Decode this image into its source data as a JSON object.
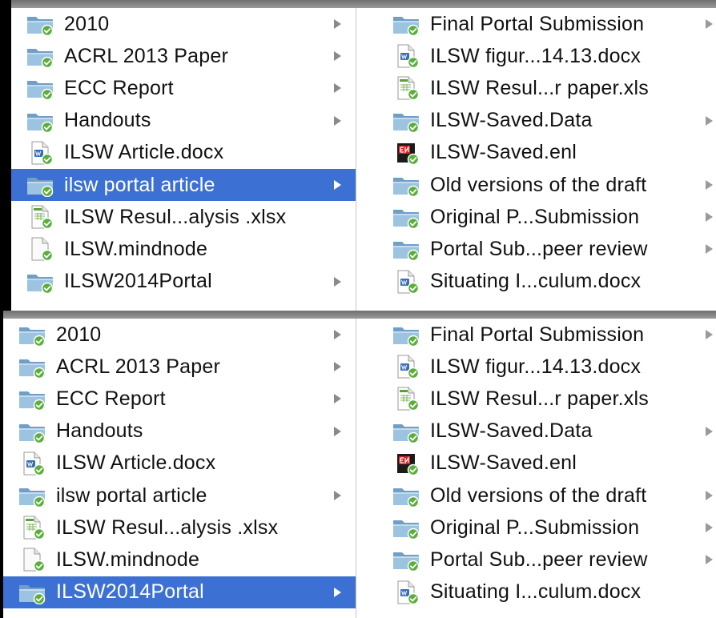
{
  "panes": [
    {
      "left_items": [
        {
          "label": "2010",
          "icon": "folder-synced-icon",
          "arrow": true,
          "selected": false
        },
        {
          "label": "ACRL 2013 Paper",
          "icon": "folder-synced-icon",
          "arrow": true,
          "selected": false
        },
        {
          "label": "ECC Report",
          "icon": "folder-synced-icon",
          "arrow": true,
          "selected": false
        },
        {
          "label": "Handouts",
          "icon": "folder-synced-icon",
          "arrow": true,
          "selected": false
        },
        {
          "label": "ILSW Article.docx",
          "icon": "word-document-synced-icon",
          "arrow": false,
          "selected": false
        },
        {
          "label": "ilsw portal article",
          "icon": "folder-synced-icon",
          "arrow": true,
          "selected": true
        },
        {
          "label": "ILSW Resul...alysis .xlsx",
          "icon": "excel-document-synced-icon",
          "arrow": false,
          "selected": false
        },
        {
          "label": "ILSW.mindnode",
          "icon": "blank-document-synced-icon",
          "arrow": false,
          "selected": false
        },
        {
          "label": "ILSW2014Portal",
          "icon": "folder-synced-icon",
          "arrow": true,
          "selected": false
        }
      ],
      "right_items": [
        {
          "label": "Final Portal Submission",
          "icon": "folder-synced-icon",
          "arrow": true
        },
        {
          "label": "ILSW figur...14.13.docx",
          "icon": "word-document-synced-icon",
          "arrow": false
        },
        {
          "label": "ILSW Resul...r paper.xls",
          "icon": "excel-document-synced-icon",
          "arrow": false
        },
        {
          "label": "ILSW-Saved.Data",
          "icon": "folder-synced-icon",
          "arrow": true
        },
        {
          "label": "ILSW-Saved.enl",
          "icon": "endnote-library-synced-icon",
          "arrow": false
        },
        {
          "label": "Old versions of the draft",
          "icon": "folder-synced-icon",
          "arrow": true
        },
        {
          "label": "Original P...Submission",
          "icon": "folder-synced-icon",
          "arrow": true
        },
        {
          "label": "Portal Sub...peer review",
          "icon": "folder-synced-icon",
          "arrow": true
        },
        {
          "label": "Situating I...culum.docx",
          "icon": "word-document-synced-icon",
          "arrow": false
        }
      ]
    },
    {
      "left_items": [
        {
          "label": "2010",
          "icon": "folder-synced-icon",
          "arrow": true,
          "selected": false
        },
        {
          "label": "ACRL 2013 Paper",
          "icon": "folder-synced-icon",
          "arrow": true,
          "selected": false
        },
        {
          "label": "ECC Report",
          "icon": "folder-synced-icon",
          "arrow": true,
          "selected": false
        },
        {
          "label": "Handouts",
          "icon": "folder-synced-icon",
          "arrow": true,
          "selected": false
        },
        {
          "label": "ILSW Article.docx",
          "icon": "word-document-synced-icon",
          "arrow": false,
          "selected": false
        },
        {
          "label": "ilsw portal article",
          "icon": "folder-synced-icon",
          "arrow": true,
          "selected": false
        },
        {
          "label": "ILSW Resul...alysis .xlsx",
          "icon": "excel-document-synced-icon",
          "arrow": false,
          "selected": false
        },
        {
          "label": "ILSW.mindnode",
          "icon": "blank-document-synced-icon",
          "arrow": false,
          "selected": false
        },
        {
          "label": "ILSW2014Portal",
          "icon": "folder-synced-icon",
          "arrow": true,
          "selected": true
        }
      ],
      "right_items": [
        {
          "label": "Final Portal Submission",
          "icon": "folder-synced-icon",
          "arrow": true
        },
        {
          "label": "ILSW figur...14.13.docx",
          "icon": "word-document-synced-icon",
          "arrow": false
        },
        {
          "label": "ILSW Resul...r paper.xls",
          "icon": "excel-document-synced-icon",
          "arrow": false
        },
        {
          "label": "ILSW-Saved.Data",
          "icon": "folder-synced-icon",
          "arrow": true
        },
        {
          "label": "ILSW-Saved.enl",
          "icon": "endnote-library-synced-icon",
          "arrow": false
        },
        {
          "label": "Old versions of the draft",
          "icon": "folder-synced-icon",
          "arrow": true
        },
        {
          "label": "Original P...Submission",
          "icon": "folder-synced-icon",
          "arrow": true
        },
        {
          "label": "Portal Sub...peer review",
          "icon": "folder-synced-icon",
          "arrow": true
        },
        {
          "label": "Situating I...culum.docx",
          "icon": "word-document-synced-icon",
          "arrow": false
        }
      ]
    }
  ],
  "colors": {
    "selection": "#3c71d3",
    "folder": "#9cc3e0",
    "sync_badge": "#5cae3c"
  }
}
